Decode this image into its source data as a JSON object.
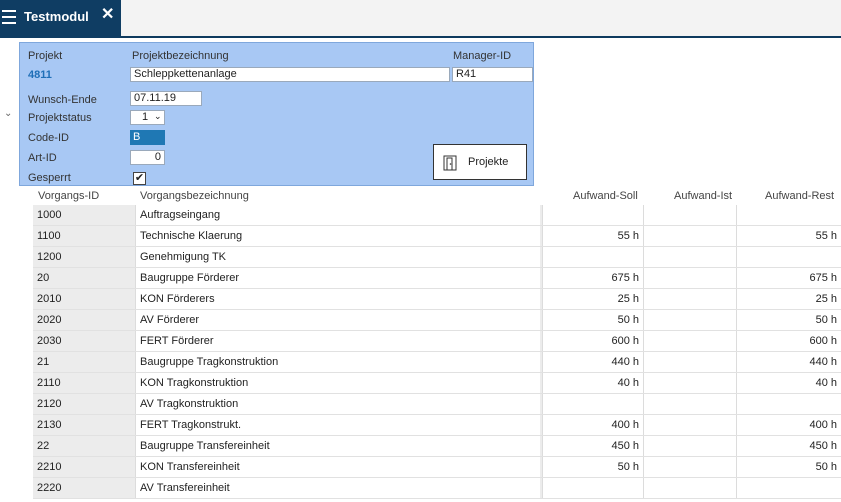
{
  "tab": {
    "title": "Testmodul",
    "close": "✕"
  },
  "form": {
    "labels": {
      "projekt": "Projekt",
      "bezeichnung": "Projektbezeichnung",
      "manager": "Manager-ID",
      "wunsch_ende": "Wunsch-Ende",
      "status": "Projektstatus",
      "code": "Code-ID",
      "art": "Art-ID",
      "gesperrt": "Gesperrt"
    },
    "values": {
      "projekt": "4811",
      "bezeichnung": "Schleppkettenanlage",
      "manager": "R41",
      "wunsch_ende": "07.11.19",
      "status": "1",
      "code": "B",
      "art": "0",
      "gesperrt_check": "✔"
    },
    "projekte_button": "Projekte"
  },
  "table": {
    "headers": {
      "id": "Vorgangs-ID",
      "desc": "Vorgangsbezeichnung",
      "soll": "Aufwand-Soll",
      "ist": "Aufwand-Ist",
      "rest": "Aufwand-Rest"
    },
    "rows": [
      {
        "id": "1000",
        "desc": "Auftragseingang",
        "soll": "",
        "ist": "",
        "rest": ""
      },
      {
        "id": "1100",
        "desc": "Technische Klaerung",
        "soll": "55 h",
        "ist": "",
        "rest": "55 h"
      },
      {
        "id": "1200",
        "desc": "Genehmigung TK",
        "soll": "",
        "ist": "",
        "rest": ""
      },
      {
        "id": "20",
        "desc": "Baugruppe Förderer",
        "soll": "675 h",
        "ist": "",
        "rest": "675 h"
      },
      {
        "id": "2010",
        "desc": "KON Förderers",
        "soll": "25 h",
        "ist": "",
        "rest": "25 h"
      },
      {
        "id": "2020",
        "desc": "AV Förderer",
        "soll": "50 h",
        "ist": "",
        "rest": "50 h"
      },
      {
        "id": "2030",
        "desc": "FERT Förderer",
        "soll": "600 h",
        "ist": "",
        "rest": "600 h"
      },
      {
        "id": "21",
        "desc": "Baugruppe Tragkonstruktion",
        "soll": "440 h",
        "ist": "",
        "rest": "440 h"
      },
      {
        "id": "2110",
        "desc": "KON Tragkonstruktion",
        "soll": "40 h",
        "ist": "",
        "rest": "40 h"
      },
      {
        "id": "2120",
        "desc": "AV Tragkonstruktion",
        "soll": "",
        "ist": "",
        "rest": ""
      },
      {
        "id": "2130",
        "desc": "FERT Tragkonstrukt.",
        "soll": "400 h",
        "ist": "",
        "rest": "400 h"
      },
      {
        "id": "22",
        "desc": "Baugruppe Transfereinheit",
        "soll": "450 h",
        "ist": "",
        "rest": "450 h"
      },
      {
        "id": "2210",
        "desc": "KON Transfereinheit",
        "soll": "50 h",
        "ist": "",
        "rest": "50 h"
      },
      {
        "id": "2220",
        "desc": "AV Transfereinheit",
        "soll": "",
        "ist": "",
        "rest": ""
      }
    ]
  }
}
